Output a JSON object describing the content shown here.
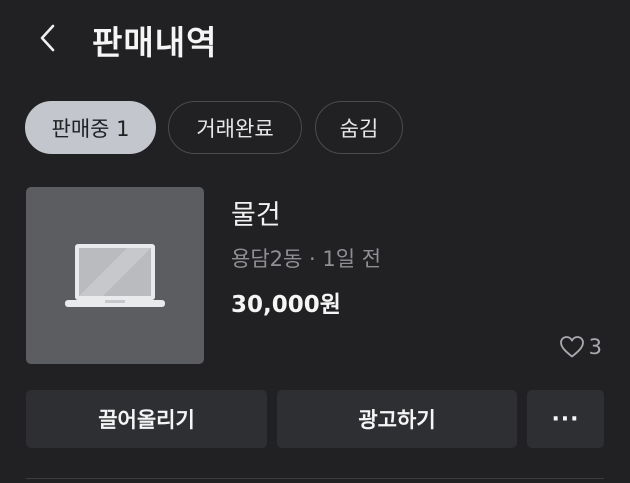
{
  "header": {
    "title": "판매내역",
    "back_icon": "chevron-left-icon"
  },
  "tabs": [
    {
      "label": "판매중 1",
      "active": true
    },
    {
      "label": "거래완료",
      "active": false
    },
    {
      "label": "숨김",
      "active": false
    }
  ],
  "item": {
    "thumbnail_icon": "laptop-icon",
    "title": "물건",
    "meta": "용담2동 · 1일 전",
    "price": "30,000원",
    "likes": "3",
    "like_icon": "heart-icon"
  },
  "actions": {
    "bump_label": "끌어올리기",
    "ad_label": "광고하기",
    "more_label": "···"
  },
  "colors": {
    "background": "#212123",
    "active_tab_bg": "#c3c6cc",
    "button_bg": "#2d2f33",
    "muted_text": "#8f9095"
  }
}
